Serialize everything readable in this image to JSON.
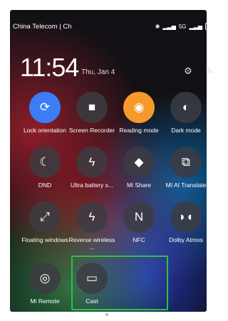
{
  "status_bar": {
    "carrier": "China Telecom | Ch",
    "signal_text": "5G",
    "battery": "100"
  },
  "header": {
    "time": "11:54",
    "date": "Thu, Jan 4"
  },
  "tiles": [
    {
      "label": "Lock orientation",
      "icon": "lock-rotate-icon",
      "state": "on"
    },
    {
      "label": "Screen Recorder",
      "icon": "video-camera-icon",
      "state": "off"
    },
    {
      "label": "Reading mode",
      "icon": "eye-icon",
      "state": "on-orange"
    },
    {
      "label": "Dark mode",
      "icon": "contrast-icon",
      "state": "off"
    },
    {
      "label": "DND",
      "icon": "moon-icon",
      "state": "off"
    },
    {
      "label": "Ultra battery s...",
      "icon": "lightning-icon",
      "state": "off"
    },
    {
      "label": "Mi Share",
      "icon": "share-icon",
      "state": "off"
    },
    {
      "label": "MI AI Translate",
      "icon": "translate-icon",
      "state": "off"
    },
    {
      "label": "Floating windows",
      "icon": "floating-window-icon",
      "state": "off"
    },
    {
      "label": "Reverse wireless ...",
      "icon": "wireless-charge-icon",
      "state": "off"
    },
    {
      "label": "NFC",
      "icon": "nfc-icon",
      "state": "off"
    },
    {
      "label": "Dolby Atmos",
      "icon": "dolby-icon",
      "state": "off"
    },
    {
      "label": "Mi Remote",
      "icon": "remote-icon",
      "state": "off"
    },
    {
      "label": "Cast",
      "icon": "cast-icon",
      "state": "off"
    }
  ],
  "page_indicator": {
    "pages": 2,
    "active": 1
  },
  "colors": {
    "accent_blue": "#3a7ef6",
    "accent_orange": "#f59a2a",
    "highlight_green": "#2ec23a"
  }
}
